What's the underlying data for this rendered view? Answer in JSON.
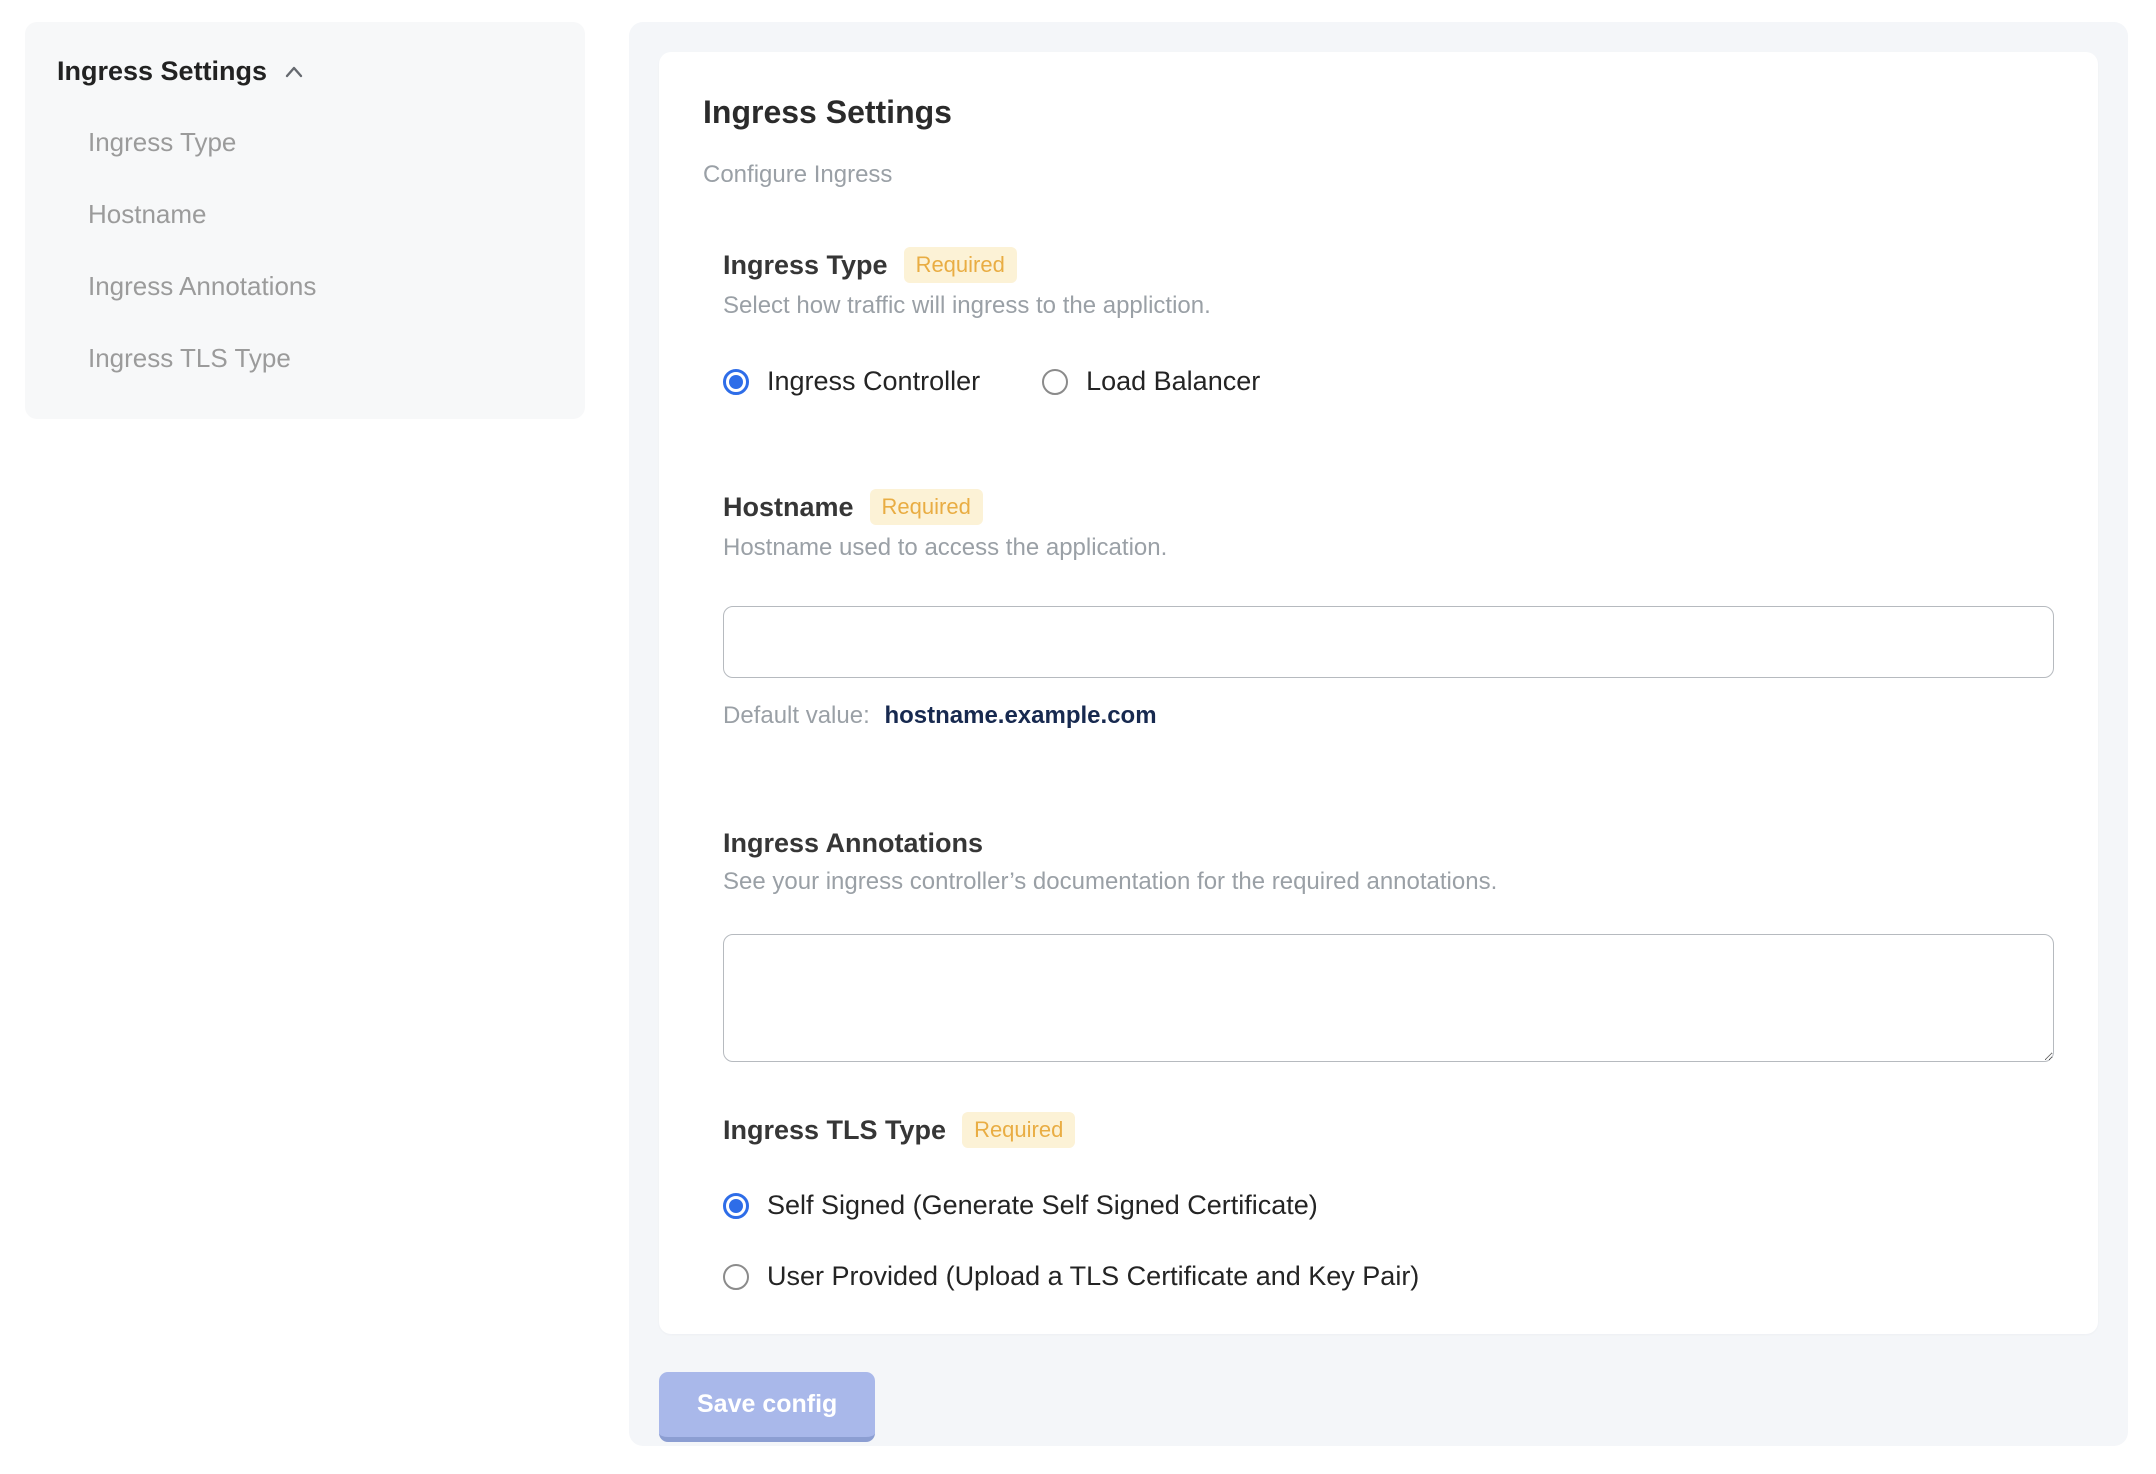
{
  "sidebar": {
    "heading": "Ingress Settings",
    "items": [
      {
        "label": "Ingress Type"
      },
      {
        "label": "Hostname"
      },
      {
        "label": "Ingress Annotations"
      },
      {
        "label": "Ingress TLS Type"
      }
    ]
  },
  "main": {
    "title": "Ingress Settings",
    "subtitle": "Configure Ingress",
    "required_badge": "Required",
    "sections": {
      "ingress_type": {
        "label": "Ingress Type",
        "required": true,
        "description": "Select how traffic will ingress to the appliction.",
        "options": [
          {
            "label": "Ingress Controller",
            "selected": true
          },
          {
            "label": "Load Balancer",
            "selected": false
          }
        ]
      },
      "hostname": {
        "label": "Hostname",
        "required": true,
        "description": "Hostname used to access the application.",
        "input_value": "",
        "default_value_label": "Default value:",
        "default_value": "hostname.example.com"
      },
      "ingress_annotations": {
        "label": "Ingress Annotations",
        "required": false,
        "description": "See your ingress controller’s documentation for the required annotations.",
        "textarea_value": ""
      },
      "ingress_tls_type": {
        "label": "Ingress TLS Type",
        "required": true,
        "options": [
          {
            "label": "Self Signed (Generate Self Signed Certificate)",
            "selected": true
          },
          {
            "label": "User Provided (Upload a TLS Certificate and Key Pair)",
            "selected": false
          }
        ]
      }
    },
    "save_button": "Save config"
  },
  "colors": {
    "accent_blue": "#2e6de8",
    "badge_bg": "#fcf2d6",
    "badge_text": "#e9ad43",
    "save_button_bg": "#a9b8ea",
    "save_button_edge": "#8c9ed2",
    "default_value_text": "#17294f",
    "panel_bg": "#f4f6f9",
    "sidebar_bg": "#f7f8f9"
  }
}
